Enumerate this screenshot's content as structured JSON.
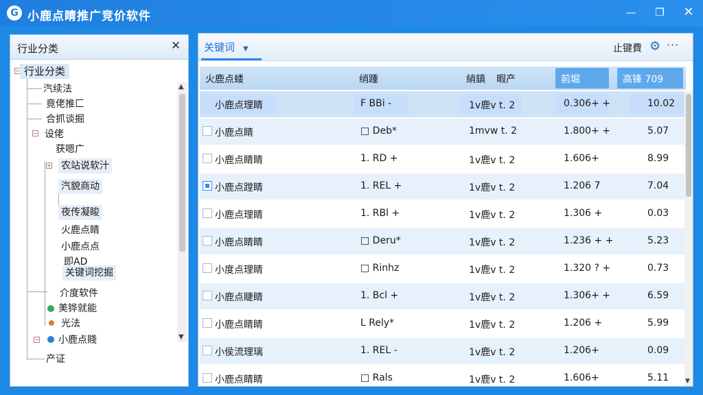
{
  "app": {
    "logo_text": "G",
    "title": "小鹿点睛推广竞价软件",
    "minimize": "—",
    "maximize": "❐",
    "close": "✕"
  },
  "left_panel": {
    "title": "行业分类",
    "close": "✕",
    "tree": [
      "行业分类",
      "汽续法",
      "竟佬推匚",
      "合抓谈掘",
      "设佬",
      "获嗯广",
      "农站说软汁",
      "汽貌商动",
      "夜传凝睃",
      "火鹿点睛",
      "小鹿点点",
      "即AD",
      "关键词挖掘",
      "介度软件",
      "美铧就能",
      "光法",
      "小鹿点賤",
      "产证"
    ]
  },
  "toolbar": {
    "keyword_label": "关键词",
    "caret": "▼",
    "right_label": "止键費",
    "gear": "⚙",
    "more": "···"
  },
  "table": {
    "headers": [
      "火鹿点蝼",
      "绡踵",
      "綃鎮",
      "暇产",
      "前堀",
      "高锋 709"
    ],
    "rows": [
      {
        "checked": false,
        "name": "小鹿点理睛",
        "c2": "F BBi -",
        "c3": "1v鹿v t. 2",
        "c4": "0.306+ +",
        "c5": "10.02"
      },
      {
        "checked": false,
        "name": "小鹿点睛",
        "c2": "□ Deb*",
        "c3": "1mvw t. 2",
        "c4": "1.800+ +",
        "c5": "5.07"
      },
      {
        "checked": false,
        "name": "小鹿点睛睛",
        "c2": "1. RD +",
        "c3": "1v鹿v t. 2",
        "c4": "1.606+",
        "c5": "8.99"
      },
      {
        "checked": true,
        "name": "小鹿点蹚睛",
        "c2": "1. REL +",
        "c3": "1v鹿v t. 2",
        "c4": "1.206 7",
        "c5": "7.04"
      },
      {
        "checked": false,
        "name": "小鹿点理睛",
        "c2": "1. RBl +",
        "c3": "1v鹿v t. 2",
        "c4": "1.306 +",
        "c5": "0.03"
      },
      {
        "checked": false,
        "name": "小鹿点睛睛",
        "c2": "□ Deru*",
        "c3": "1v鹿v t. 2",
        "c4": "1.236 + +",
        "c5": "5.23"
      },
      {
        "checked": false,
        "name": "小度点理睛",
        "c2": "□ Rinhz",
        "c3": "1v鹿v t. 2",
        "c4": "1.320 ? +",
        "c5": "0.73"
      },
      {
        "checked": false,
        "name": "小鹿点睫睛",
        "c2": "1. Bcl +",
        "c3": "1v鹿v t. 2",
        "c4": "1.306+ +",
        "c5": "6.59"
      },
      {
        "checked": false,
        "name": "小鹿点睛睛",
        "c2": "L Rely*",
        "c3": "1v鹿v t. 2",
        "c4": "1.206 +",
        "c5": "5.99"
      },
      {
        "checked": false,
        "name": "小侯流理璃",
        "c2": "1. REL -",
        "c3": "1v鹿v t. 2",
        "c4": "1.206+",
        "c5": "0.09"
      },
      {
        "checked": false,
        "name": "小鹿点睛睛",
        "c2": "□ Rals",
        "c3": "1v鹿v t. 2",
        "c4": "1.606+",
        "c5": "5.11"
      }
    ]
  },
  "colors": {
    "brand": "#1e88e5",
    "header_pill": "#5fa8ec",
    "row_alt": "#e6f1fc"
  }
}
